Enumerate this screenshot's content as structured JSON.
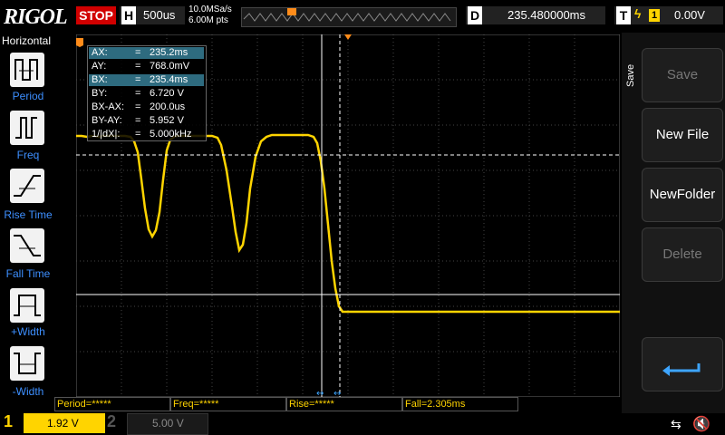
{
  "top": {
    "logo": "RIGOL",
    "run_state": "STOP",
    "h_label": "H",
    "timebase": "500us",
    "sample_rate": "10.0MSa/s",
    "memory_depth": "6.00M pts",
    "d_label": "D",
    "delay": "235.480000ms",
    "t_label": "T",
    "trigger_source": "1",
    "trigger_level": "0.00V"
  },
  "left_menu": {
    "title": "Horizontal",
    "items": [
      {
        "label": "Period",
        "icon": "period-icon"
      },
      {
        "label": "Freq",
        "icon": "freq-icon"
      },
      {
        "label": "Rise Time",
        "icon": "rise-time-icon"
      },
      {
        "label": "Fall Time",
        "icon": "fall-time-icon"
      },
      {
        "label": "+Width",
        "icon": "positive-width-icon"
      },
      {
        "label": "-Width",
        "icon": "negative-width-icon"
      }
    ]
  },
  "measurements": {
    "rows": [
      {
        "key": "AX:",
        "eq": "=",
        "value": "235.2ms",
        "highlight": true
      },
      {
        "key": "AY:",
        "eq": "=",
        "value": "768.0mV",
        "highlight": false
      },
      {
        "key": "BX:",
        "eq": "=",
        "value": "235.4ms",
        "highlight": true
      },
      {
        "key": "BY:",
        "eq": "=",
        "value": "6.720 V",
        "highlight": false
      },
      {
        "key": "BX-AX:",
        "eq": "=",
        "value": "200.0us",
        "highlight": false
      },
      {
        "key": "BY-AY:",
        "eq": "=",
        "value": "5.952 V",
        "highlight": false
      },
      {
        "key": "1/|dX|:",
        "eq": "=",
        "value": "5.000kHz",
        "highlight": false
      }
    ]
  },
  "right_menu": {
    "title": "Save",
    "buttons": [
      {
        "label": "Save",
        "enabled": false
      },
      {
        "label": "New File",
        "enabled": true
      },
      {
        "label": "NewFolder",
        "enabled": true
      },
      {
        "label": "Delete",
        "enabled": false
      }
    ],
    "back_icon": "return-arrow-icon"
  },
  "bottom_measure": {
    "period": "Period=*****",
    "freq": "Freq=*****",
    "rise": "Rise=*****",
    "fall": "Fall=2.305ms"
  },
  "channels": {
    "ch1_num": "1",
    "ch1_scale": "1.92 V",
    "ch2_num": "2",
    "ch2_scale": "5.00 V"
  },
  "colors": {
    "trace": "#ffd400",
    "stop": "#d10000",
    "menu_label": "#3d8fff",
    "cursor_highlight": "#2e6b7f"
  }
}
